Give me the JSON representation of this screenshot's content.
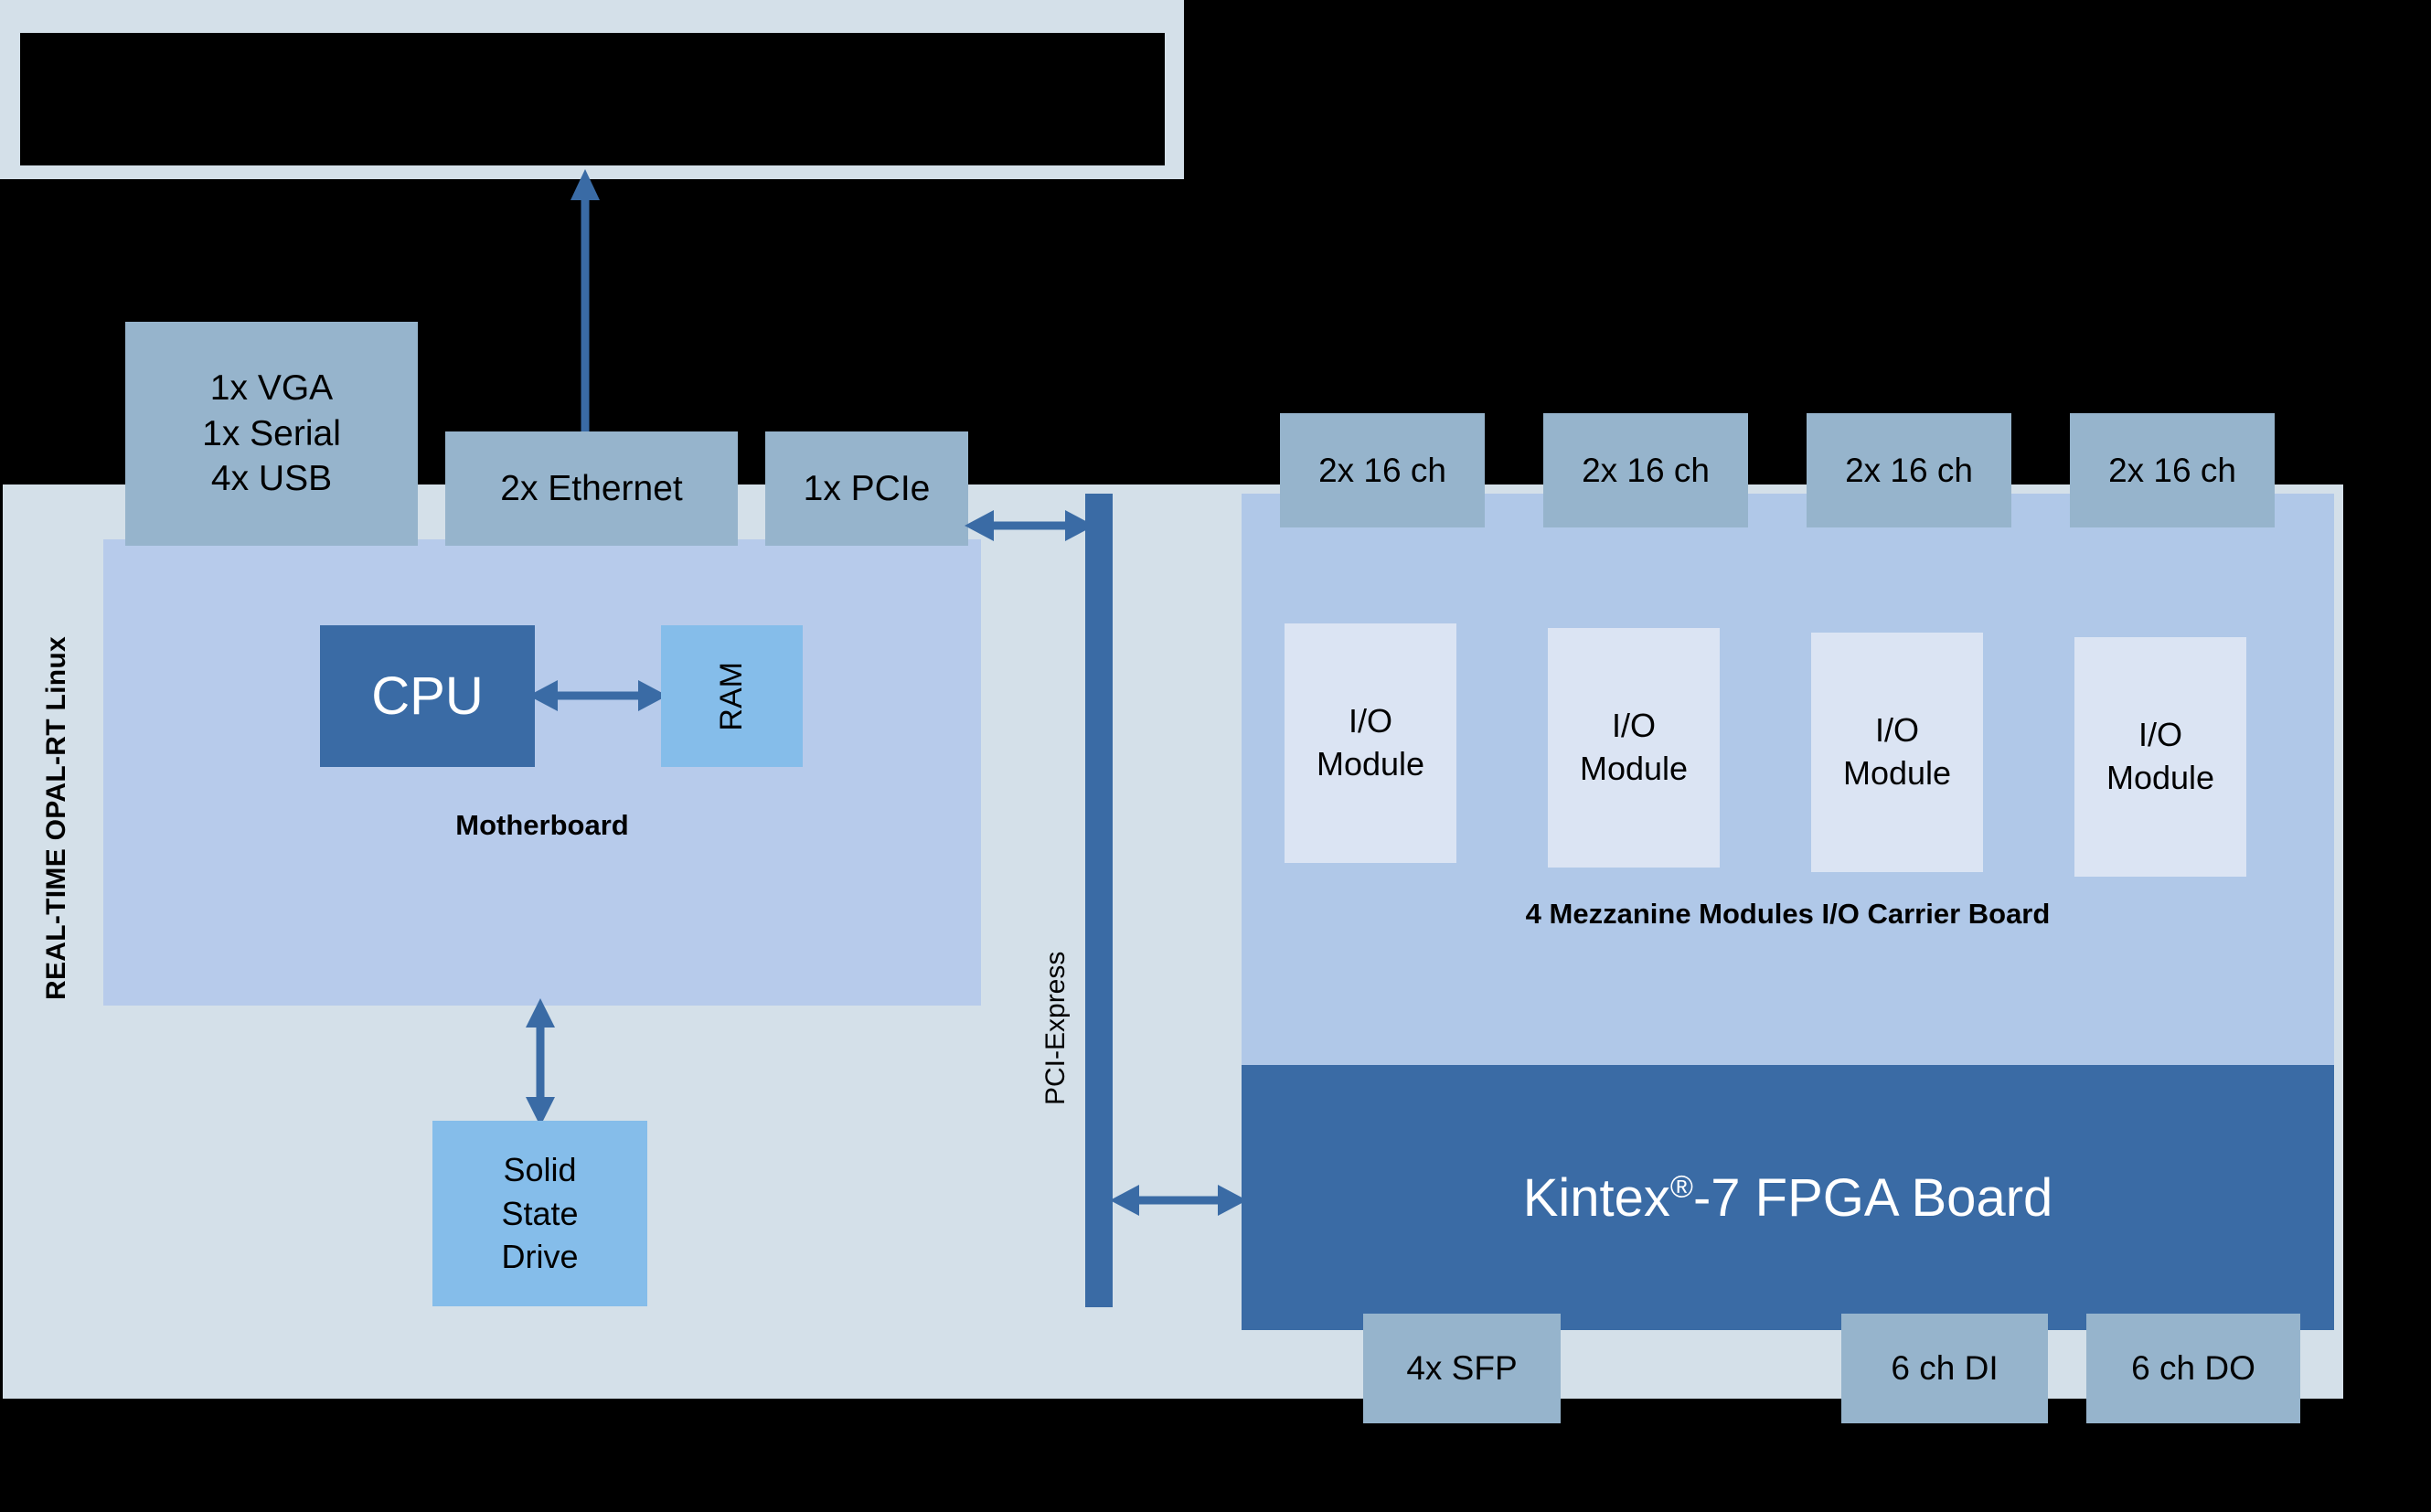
{
  "title_bar": {
    "redacted": true,
    "label": ""
  },
  "enclosure": {
    "side_label": "REAL-TIME OPAL-RT Linux",
    "bg_color": "#d4e0e9"
  },
  "motherboard": {
    "label": "Motherboard",
    "bg_color": "#b7cbeb",
    "cpu": {
      "label": "CPU",
      "color": "#3a6ba5",
      "text_color": "#ffffff"
    },
    "ram": {
      "label": "RAM",
      "color": "#85bdea"
    },
    "ssd": {
      "label": "Solid\nState\nDrive",
      "lines": [
        "Solid",
        "State",
        "Drive"
      ],
      "color": "#85bdea"
    },
    "connectors": [
      {
        "name": "io-left",
        "lines": [
          "1x VGA",
          "1x Serial",
          "4x USB"
        ]
      },
      {
        "name": "ethernet",
        "lines": [
          "2x Ethernet"
        ]
      },
      {
        "name": "pcie",
        "lines": [
          "1x PCIe"
        ]
      }
    ]
  },
  "interconnect": {
    "label": "PCI-Express",
    "color": "#3a6ba5"
  },
  "carrier_board": {
    "label": "4 Mezzanine Modules I/O Carrier Board",
    "bg_color": "#b0c8e8",
    "channel_boxes": [
      "2x 16 ch",
      "2x 16 ch",
      "2x 16 ch",
      "2x 16 ch"
    ],
    "modules": [
      {
        "line1": "I/O",
        "line2": "Module"
      },
      {
        "line1": "I/O",
        "line2": "Module"
      },
      {
        "line1": "I/O",
        "line2": "Module"
      },
      {
        "line1": "I/O",
        "line2": "Module"
      }
    ]
  },
  "fpga_board": {
    "name_prefix": "Kintex",
    "registered_mark": "®",
    "name_suffix": "-7 FPGA Board",
    "full_label": "Kintex®-7 FPGA Board",
    "color": "#3a6ba5",
    "text_color": "#ffffff",
    "connectors": [
      "4x SFP",
      "6 ch DI",
      "6 ch DO"
    ]
  },
  "accent": {
    "arrow_color": "#3a6ba5",
    "dark_blue": "#3a6ba5",
    "mid_blue": "#96b4cc",
    "light_blue": "#85bdea",
    "panel_blue": "#b0c8e8",
    "pale_blue": "#dbe4f3",
    "enclosure_gray": "#d4e0e9"
  }
}
